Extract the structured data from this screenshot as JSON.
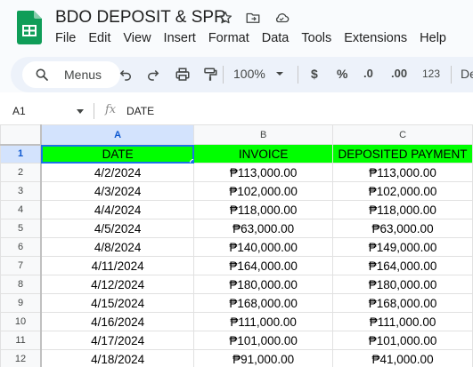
{
  "app": {
    "title": "BDO DEPOSIT & SPR",
    "brand_color": "#0f9d58",
    "menu": [
      "File",
      "Edit",
      "View",
      "Insert",
      "Format",
      "Data",
      "Tools",
      "Extensions",
      "Help"
    ]
  },
  "toolbar": {
    "menus_label": "Menus",
    "zoom": "100%",
    "currency_symbol": "$",
    "percent_symbol": "%",
    "decrease_decimal": ".0",
    "increase_decimal": ".00",
    "number_format": "123",
    "font_label": "De"
  },
  "formula_bar": {
    "cell_ref": "A1",
    "fx": "fx",
    "value": "DATE"
  },
  "sheet": {
    "columns": [
      "A",
      "B",
      "C"
    ],
    "header_fill": "#00ff00",
    "header_row": [
      "DATE",
      "INVOICE",
      "DEPOSITED PAYMENT"
    ],
    "rows": [
      [
        "4/2/2024",
        "₱113,000.00",
        "₱113,000.00"
      ],
      [
        "4/3/2024",
        "₱102,000.00",
        "₱102,000.00"
      ],
      [
        "4/4/2024",
        "₱118,000.00",
        "₱118,000.00"
      ],
      [
        "4/5/2024",
        "₱63,000.00",
        "₱63,000.00"
      ],
      [
        "4/8/2024",
        "₱140,000.00",
        "₱149,000.00"
      ],
      [
        "4/11/2024",
        "₱164,000.00",
        "₱164,000.00"
      ],
      [
        "4/12/2024",
        "₱180,000.00",
        "₱180,000.00"
      ],
      [
        "4/15/2024",
        "₱168,000.00",
        "₱168,000.00"
      ],
      [
        "4/16/2024",
        "₱111,000.00",
        "₱111,000.00"
      ],
      [
        "4/17/2024",
        "₱101,000.00",
        "₱101,000.00"
      ],
      [
        "4/18/2024",
        "₱91,000.00",
        "₱41,000.00"
      ]
    ],
    "row_numbers": [
      "1",
      "2",
      "3",
      "4",
      "5",
      "6",
      "7",
      "8",
      "9",
      "10",
      "11",
      "12"
    ]
  }
}
